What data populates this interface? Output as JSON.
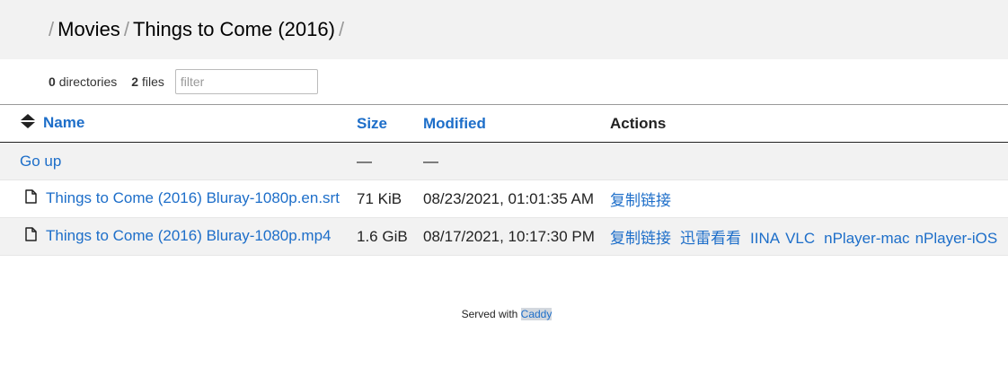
{
  "breadcrumb": {
    "separator": "/",
    "items": [
      "Movies",
      "Things to Come (2016)"
    ]
  },
  "summary": {
    "dir_count": "0",
    "dir_label": "directories",
    "file_count": "2",
    "file_label": "files",
    "filter_placeholder": "filter"
  },
  "table": {
    "headers": {
      "name": "Name",
      "size": "Size",
      "modified": "Modified",
      "actions": "Actions"
    },
    "go_up": {
      "label": "Go up",
      "size": "—",
      "modified": "—"
    },
    "rows": [
      {
        "name": "Things to Come (2016) Bluray-1080p.en.srt",
        "size": "71 KiB",
        "modified": "08/23/2021, 01:01:35 AM",
        "actions": [
          "复制链接"
        ]
      },
      {
        "name": "Things to Come (2016) Bluray-1080p.mp4",
        "size": "1.6 GiB",
        "modified": "08/17/2021, 10:17:30 PM",
        "actions": [
          "复制链接",
          "迅雷看看",
          "IINA",
          "VLC",
          "nPlayer-mac",
          "nPlayer-iOS"
        ]
      }
    ]
  },
  "footer": {
    "prefix": "Served with",
    "link": "Caddy"
  },
  "colors": {
    "link": "#1d6ec9",
    "header_bg": "#f2f2f2"
  },
  "icons": {
    "sort": "sort-arrows-icon",
    "file": "file-icon"
  }
}
